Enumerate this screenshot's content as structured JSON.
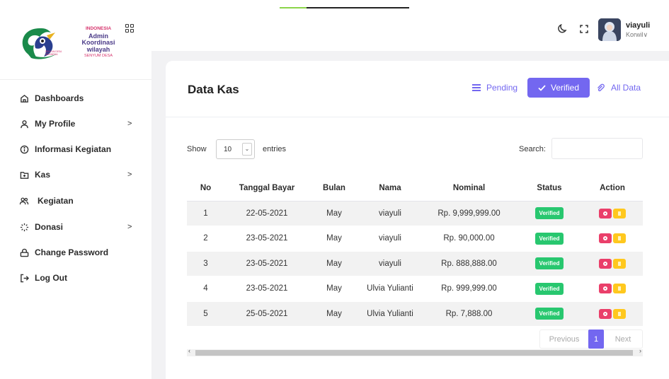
{
  "logo": {
    "line1": "INDONESIA",
    "line2": "Admin",
    "line3": "Koordinasi",
    "line4": "wilayah",
    "line5": "SENYUM DESA"
  },
  "sidebar": {
    "items": [
      {
        "label": "Dashboards",
        "icon": "home-icon",
        "chevron": ""
      },
      {
        "label": "My Profile",
        "icon": "user-icon",
        "chevron": ">"
      },
      {
        "label": "Informasi Kegiatan",
        "icon": "info-icon",
        "chevron": ""
      },
      {
        "label": "Kas",
        "icon": "folder-plus-icon",
        "chevron": ">"
      },
      {
        "label": "Kegiatan",
        "icon": "users-icon",
        "chevron": ""
      },
      {
        "label": "Donasi",
        "icon": "loader-icon",
        "chevron": ">"
      },
      {
        "label": "Change Password",
        "icon": "lock-icon",
        "chevron": ""
      },
      {
        "label": "Log Out",
        "icon": "logout-icon",
        "chevron": ""
      }
    ]
  },
  "header": {
    "user_name": "viayuli",
    "user_role": "Korwil∨"
  },
  "card": {
    "title": "Data Kas",
    "filter_pending": "Pending",
    "filter_verified": "Verified",
    "filter_all": "All Data"
  },
  "table_controls": {
    "show_label": "Show",
    "entries_value": "10",
    "entries_label": "entries",
    "search_label": "Search:",
    "search_value": ""
  },
  "table": {
    "columns": [
      "No",
      "Tanggal Bayar",
      "Bulan",
      "Nama",
      "Nominal",
      "Status",
      "Action"
    ],
    "rows": [
      {
        "no": "1",
        "date": "22-05-2021",
        "month": "May",
        "name": "viayuli",
        "amount": "Rp. 9,999,999.00",
        "status": "Verified"
      },
      {
        "no": "2",
        "date": "23-05-2021",
        "month": "May",
        "name": "viayuli",
        "amount": "Rp. 90,000.00",
        "status": "Verified"
      },
      {
        "no": "3",
        "date": "23-05-2021",
        "month": "May",
        "name": "viayuli",
        "amount": "Rp. 888,888.00",
        "status": "Verified"
      },
      {
        "no": "4",
        "date": "23-05-2021",
        "month": "May",
        "name": "Ulvia Yulianti",
        "amount": "Rp. 999,999.00",
        "status": "Verified"
      },
      {
        "no": "5",
        "date": "25-05-2021",
        "month": "May",
        "name": "Ulvia Yulianti",
        "amount": "Rp. 7,888.00",
        "status": "Verified"
      }
    ]
  },
  "pagination": {
    "previous": "Previous",
    "current": "1",
    "next": "Next"
  },
  "colors": {
    "accent": "#7367f0",
    "status_verified": "#28c76f",
    "action_view": "#ea3f6a",
    "action_edit": "#ffc81e"
  }
}
